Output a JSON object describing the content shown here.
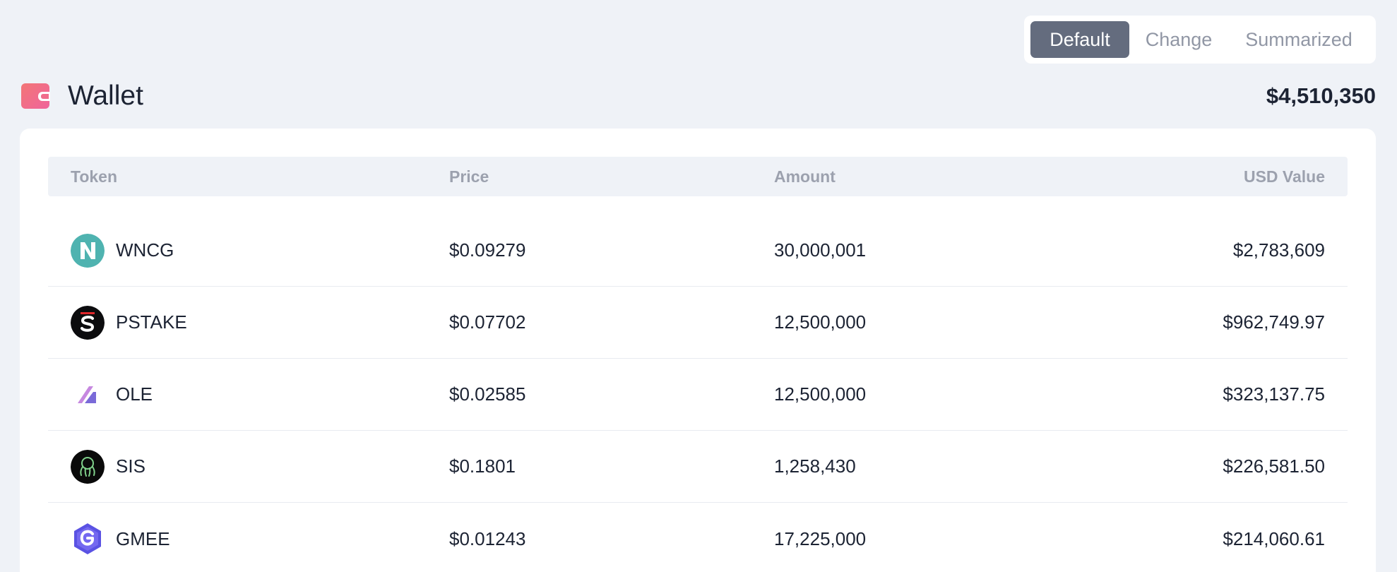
{
  "view_switch": {
    "options": [
      "Default",
      "Change",
      "Summarized"
    ],
    "selected": "Default"
  },
  "wallet": {
    "title": "Wallet",
    "total": "$4,510,350",
    "icon": "wallet-icon"
  },
  "table": {
    "headers": {
      "token": "Token",
      "price": "Price",
      "amount": "Amount",
      "usd_value": "USD Value"
    },
    "rows": [
      {
        "token": "WNCG",
        "icon": "wncg-token-icon",
        "price": "$0.09279",
        "amount": "30,000,001",
        "usd_value": "$2,783,609"
      },
      {
        "token": "PSTAKE",
        "icon": "pstake-token-icon",
        "price": "$0.07702",
        "amount": "12,500,000",
        "usd_value": "$962,749.97"
      },
      {
        "token": "OLE",
        "icon": "ole-token-icon",
        "price": "$0.02585",
        "amount": "12,500,000",
        "usd_value": "$323,137.75"
      },
      {
        "token": "SIS",
        "icon": "sis-token-icon",
        "price": "$0.1801",
        "amount": "1,258,430",
        "usd_value": "$226,581.50"
      },
      {
        "token": "GMEE",
        "icon": "gmee-token-icon",
        "price": "$0.01243",
        "amount": "17,225,000",
        "usd_value": "$214,060.61"
      }
    ]
  },
  "colors": {
    "background": "#eff2f7",
    "active_tab": "#646c7e",
    "wallet_icon": "#f27676"
  }
}
